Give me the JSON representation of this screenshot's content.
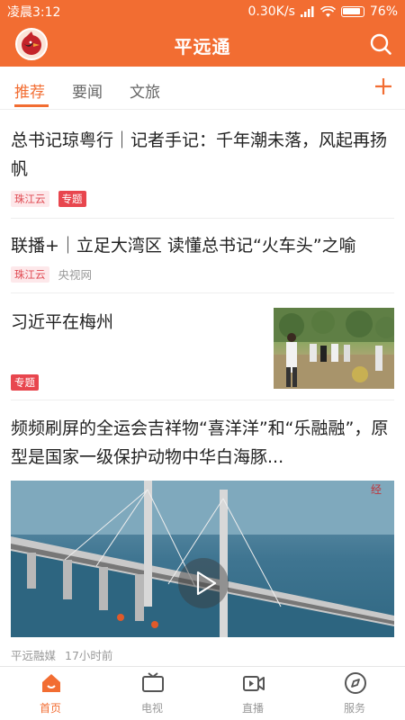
{
  "status_bar": {
    "time": "凌晨3:12",
    "speed": "0.30K/s",
    "battery": "76%"
  },
  "header": {
    "title": "平远通"
  },
  "tabs": [
    {
      "label": "推荐"
    },
    {
      "label": "要闻"
    },
    {
      "label": "文旅"
    }
  ],
  "feed": [
    {
      "title": "总书记琼粤行｜记者手记：千年潮未落，风起再扬帆",
      "source_tag": "珠江云",
      "topic_tag": "专题"
    },
    {
      "title": "联播+｜立足大湾区 读懂总书记“火车头”之喻",
      "source_tag": "珠江云",
      "source": "央视网"
    },
    {
      "title": "习近平在梅州",
      "topic_tag": "专题"
    },
    {
      "title": "频频刷屏的全运会吉祥物“喜洋洋”和“乐融融”，原型是国家一级保护动物中华白海豚...",
      "source": "平远融媒",
      "time": "17小时前"
    }
  ],
  "bottom_nav": [
    {
      "label": "首页",
      "icon": "home-icon",
      "active": true
    },
    {
      "label": "电视",
      "icon": "tv-icon"
    },
    {
      "label": "直播",
      "icon": "live-video-icon"
    },
    {
      "label": "服务",
      "icon": "compass-icon"
    }
  ],
  "colors": {
    "brand": "#f26d32",
    "tag_red": "#e8464e",
    "tag_bg": "#fde8ea",
    "text": "#222222",
    "muted": "#999999"
  }
}
